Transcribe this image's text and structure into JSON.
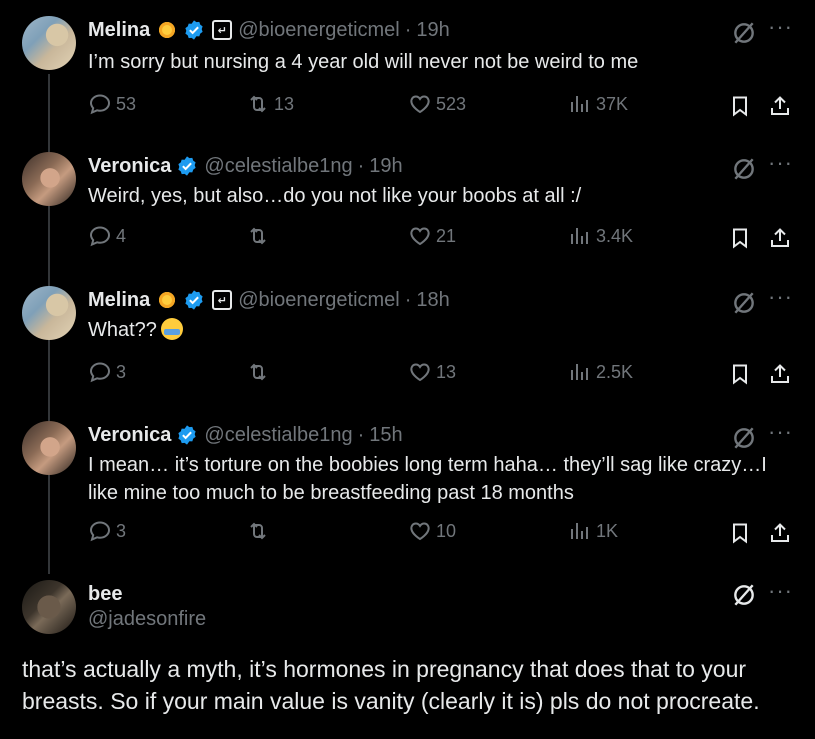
{
  "tweets": [
    {
      "name": "Melina",
      "handle": "@bioenergeticmel",
      "time": "19h",
      "text": "I’m sorry but nursing a 4 year old will never not be weird to me",
      "replies": "53",
      "retweets": "13",
      "likes": "523",
      "views": "37K",
      "has_sun_emoji": true,
      "has_box_icon": true,
      "box_icon_glyph": "↵"
    },
    {
      "name": "Veronica",
      "handle": "@celestialbe1ng",
      "time": "19h",
      "text": "Weird, yes, but also…do you not like your boobs at all :/",
      "replies": "4",
      "retweets": "",
      "likes": "21",
      "views": "3.4K"
    },
    {
      "name": "Melina",
      "handle": "@bioenergeticmel",
      "time": "18h",
      "text": "What??",
      "replies": "3",
      "retweets": "",
      "likes": "13",
      "views": "2.5K",
      "box_icon_glyph": "↵"
    },
    {
      "name": "Veronica",
      "handle": "@celestialbe1ng",
      "time": "15h",
      "text": "I mean… it’s torture on the boobies long term haha… they’ll sag like crazy…I like mine too much to be breastfeeding past 18 months",
      "replies": "3",
      "retweets": "",
      "likes": "10",
      "views": "1K"
    }
  ],
  "main_tweet": {
    "name": "bee",
    "handle": "@jadesonfire",
    "text": "that’s actually a myth, it’s hormones in pregnancy that does that to your breasts. So if your main value is vanity (clearly it is) pls do not procreate."
  },
  "dot_sep": "·",
  "more_label": "···",
  "colors": {
    "background": "#000000",
    "text": "#e7e9ea",
    "muted": "#71767b",
    "verified": "#1d9bf0",
    "line": "#333639"
  },
  "icons": [
    "reply-icon",
    "retweet-icon",
    "like-icon",
    "views-icon",
    "bookmark-icon",
    "share-icon",
    "grok-icon",
    "more-icon",
    "verified-icon",
    "sun-emoji",
    "crying-emoji"
  ]
}
